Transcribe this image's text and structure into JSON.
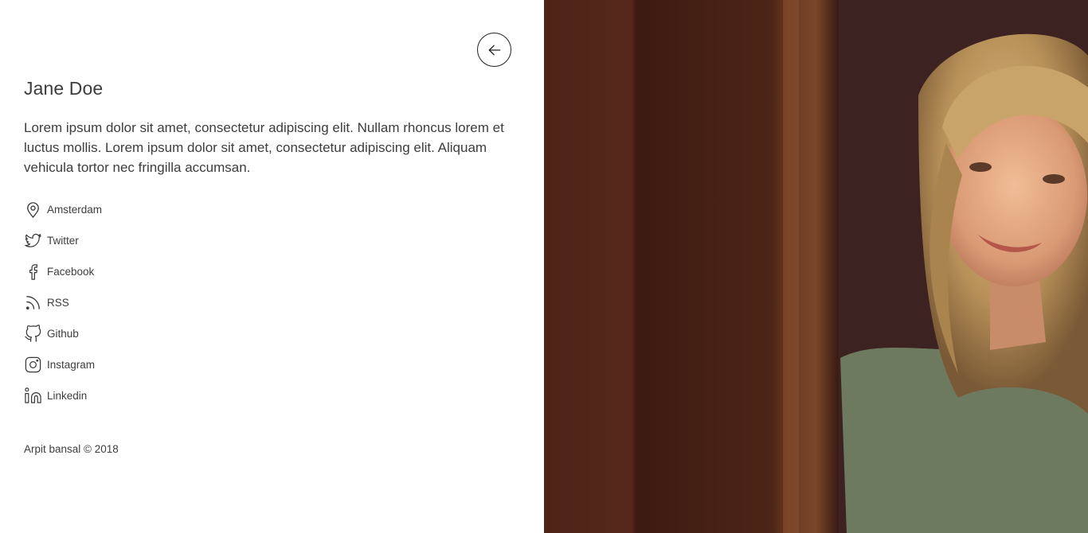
{
  "profile": {
    "name": "Jane Doe",
    "bio": "Lorem ipsum dolor sit amet, consectetur adipiscing elit. Nullam rhoncus lorem et luctus mollis. Lorem ipsum dolor sit amet, consectetur adipiscing elit. Aliquam vehicula tortor nec fringilla accumsan."
  },
  "back_button": {
    "icon": "arrow-left-icon"
  },
  "links": [
    {
      "label": "Amsterdam",
      "icon": "location-pin-icon"
    },
    {
      "label": "Twitter",
      "icon": "twitter-icon"
    },
    {
      "label": "Facebook",
      "icon": "facebook-icon"
    },
    {
      "label": "RSS",
      "icon": "rss-icon"
    },
    {
      "label": "Github",
      "icon": "github-icon"
    },
    {
      "label": "Instagram",
      "icon": "instagram-icon"
    },
    {
      "label": "Linkedin",
      "icon": "linkedin-icon"
    }
  ],
  "footer": {
    "text": "Arpit bansal © 2018"
  },
  "photo": {
    "description_icon": "profile-photo"
  }
}
